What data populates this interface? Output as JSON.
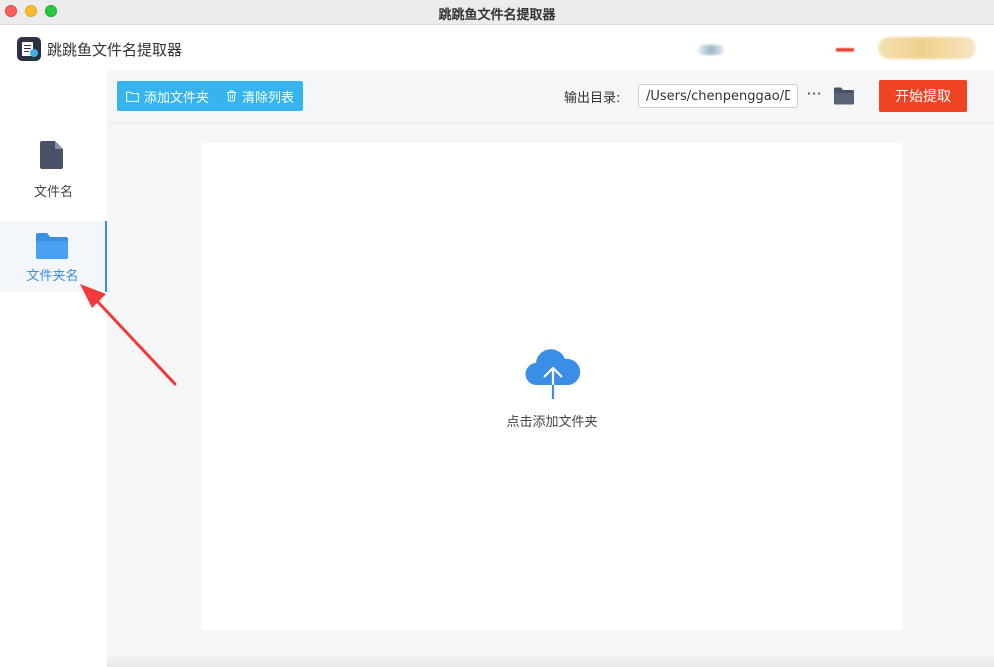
{
  "window": {
    "title": "跳跳鱼文件名提取器"
  },
  "header": {
    "app_name": "跳跳鱼文件名提取器"
  },
  "sidebar": {
    "items": [
      {
        "label": "文件名",
        "icon": "file-icon",
        "active": false
      },
      {
        "label": "文件夹名",
        "icon": "folder-icon",
        "active": true
      }
    ]
  },
  "toolbar": {
    "add_folder_label": "添加文件夹",
    "clear_list_label": "清除列表",
    "output_label": "输出目录:",
    "output_path": "/Users/chenpenggao/Desktop",
    "more_label": "···",
    "start_label": "开始提取"
  },
  "dropzone": {
    "text": "点击添加文件夹",
    "icon": "cloud-upload-icon"
  },
  "colors": {
    "accent": "#3a8ee6",
    "toolbar_button": "#35b4ee",
    "start_button": "#f04324",
    "annotation": "#f23a3a"
  }
}
